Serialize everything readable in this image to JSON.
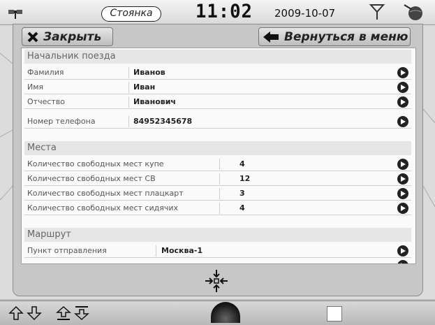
{
  "topbar": {
    "status": "Стоянка",
    "clock": "11:02",
    "date": "2009-10-07"
  },
  "toolbar": {
    "close_label": "Закрыть",
    "back_label": "Вернуться в меню"
  },
  "sections": {
    "chief": {
      "title": "Начальник поезда",
      "rows": [
        {
          "label": "Фамилия",
          "value": "Иванов"
        },
        {
          "label": "Имя",
          "value": "Иван"
        },
        {
          "label": "Отчество",
          "value": "Иванович"
        },
        {
          "label": "Номер телефона",
          "value": "84952345678"
        }
      ]
    },
    "seats": {
      "title": "Места",
      "rows": [
        {
          "label": "Количество свободных мест купе",
          "value": "4"
        },
        {
          "label": "Количество свободных мест СВ",
          "value": "12"
        },
        {
          "label": "Количество свободных мест плацкарт",
          "value": "3"
        },
        {
          "label": "Количество свободных мест сидячих",
          "value": "4"
        }
      ]
    },
    "route": {
      "title": "Маршрут",
      "rows": [
        {
          "label": "Пункт отправления",
          "value": "Москва-1"
        }
      ]
    }
  },
  "icons": {
    "top_left": "satellite-icon",
    "top_right_1": "antenna-icon",
    "top_right_2": "globe-icon",
    "bottom": [
      "arrow-up-icon",
      "arrow-down-icon",
      "page-up-icon",
      "page-down-icon"
    ],
    "center": "collapse-icon"
  }
}
